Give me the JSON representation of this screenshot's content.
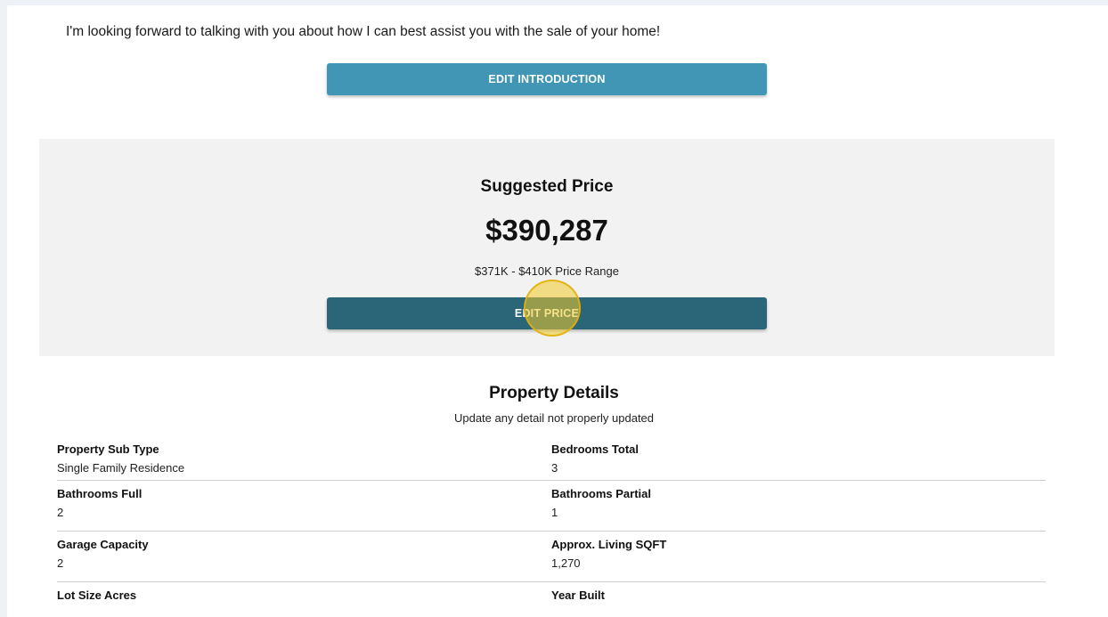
{
  "intro": {
    "text": "I'm looking forward to talking with you about how I can best assist you with the sale of your home!",
    "edit_button": "EDIT INTRODUCTION"
  },
  "price": {
    "title": "Suggested Price",
    "value": "$390,287",
    "range": "$371K - $410K Price Range",
    "edit_button": "EDIT PRICE"
  },
  "details": {
    "title": "Property Details",
    "subtitle": "Update any detail not properly updated",
    "rows": [
      [
        {
          "label": "Property Sub Type",
          "value": "Single Family Residence"
        },
        {
          "label": "Bedrooms Total",
          "value": "3"
        }
      ],
      [
        {
          "label": "Bathrooms Full",
          "value": "2"
        },
        {
          "label": "Bathrooms Partial",
          "value": "1"
        }
      ],
      [
        {
          "label": "Garage Capacity",
          "value": "2"
        },
        {
          "label": "Approx. Living SQFT",
          "value": "1,270"
        }
      ],
      [
        {
          "label": "Lot Size Acres",
          "value": ""
        },
        {
          "label": "Year Built",
          "value": ""
        }
      ]
    ]
  },
  "colors": {
    "intro_button": "#4096b4",
    "price_button": "#2b6678",
    "panel_bg": "#f2f2f2",
    "click_indicator": "#f0c828"
  }
}
